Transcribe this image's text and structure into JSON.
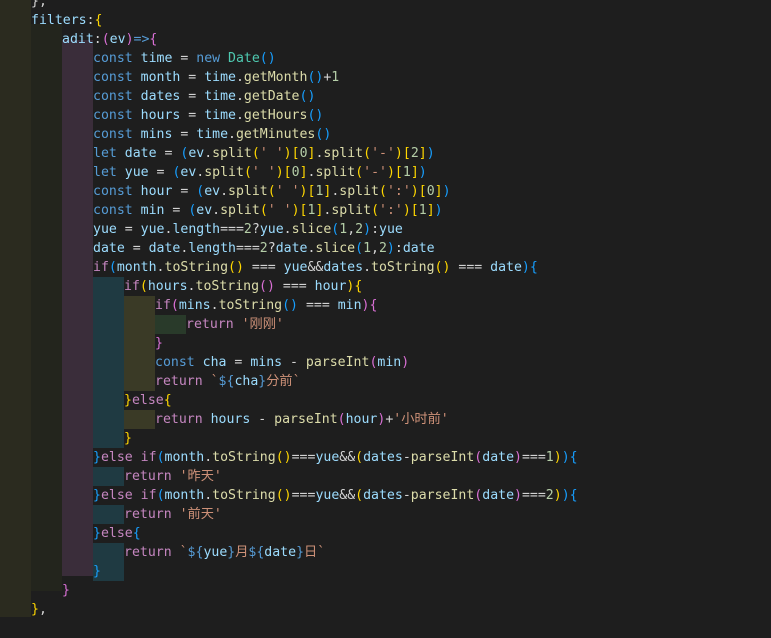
{
  "editor": {
    "background": "#1e1e1e",
    "theme_colors": {
      "keyword": "#569cd6",
      "control": "#c586c0",
      "function": "#dcdcaa",
      "number": "#b5cea8",
      "string": "#ce9178",
      "variable": "#9cdcfe",
      "bracket_level1": "#ffd700",
      "bracket_level2": "#da70d6",
      "bracket_level3": "#179fff"
    },
    "lines": [
      [
        [
          "plain",
          "},"
        ]
      ],
      [
        [
          "var",
          "filters"
        ],
        [
          "plain",
          ":"
        ],
        [
          "b1",
          "{"
        ]
      ],
      [
        [
          "var",
          "adit"
        ],
        [
          "plain",
          ":"
        ],
        [
          "b2",
          "("
        ],
        [
          "var",
          "ev"
        ],
        [
          "b2",
          ")"
        ],
        [
          "kw",
          "=>"
        ],
        [
          "b2",
          "{"
        ]
      ],
      [
        [
          "kw",
          "const"
        ],
        [
          "plain",
          " "
        ],
        [
          "var",
          "time"
        ],
        [
          "plain",
          " = "
        ],
        [
          "kw",
          "new"
        ],
        [
          "plain",
          " "
        ],
        [
          "cls",
          "Date"
        ],
        [
          "b3",
          "("
        ],
        [
          "b3",
          ")"
        ]
      ],
      [
        [
          "kw",
          "const"
        ],
        [
          "plain",
          " "
        ],
        [
          "var",
          "month"
        ],
        [
          "plain",
          " = "
        ],
        [
          "var",
          "time"
        ],
        [
          "plain",
          "."
        ],
        [
          "fn",
          "getMonth"
        ],
        [
          "b3",
          "("
        ],
        [
          "b3",
          ")"
        ],
        [
          "plain",
          "+"
        ],
        [
          "num",
          "1"
        ]
      ],
      [
        [
          "kw",
          "const"
        ],
        [
          "plain",
          " "
        ],
        [
          "var",
          "dates"
        ],
        [
          "plain",
          " = "
        ],
        [
          "var",
          "time"
        ],
        [
          "plain",
          "."
        ],
        [
          "fn",
          "getDate"
        ],
        [
          "b3",
          "("
        ],
        [
          "b3",
          ")"
        ]
      ],
      [
        [
          "kw",
          "const"
        ],
        [
          "plain",
          " "
        ],
        [
          "var",
          "hours"
        ],
        [
          "plain",
          " = "
        ],
        [
          "var",
          "time"
        ],
        [
          "plain",
          "."
        ],
        [
          "fn",
          "getHours"
        ],
        [
          "b3",
          "("
        ],
        [
          "b3",
          ")"
        ]
      ],
      [
        [
          "kw",
          "const"
        ],
        [
          "plain",
          " "
        ],
        [
          "var",
          "mins"
        ],
        [
          "plain",
          " = "
        ],
        [
          "var",
          "time"
        ],
        [
          "plain",
          "."
        ],
        [
          "fn",
          "getMinutes"
        ],
        [
          "b3",
          "("
        ],
        [
          "b3",
          ")"
        ]
      ],
      [
        [
          "kw",
          "let"
        ],
        [
          "plain",
          " "
        ],
        [
          "var",
          "date"
        ],
        [
          "plain",
          " = "
        ],
        [
          "b3",
          "("
        ],
        [
          "var",
          "ev"
        ],
        [
          "plain",
          "."
        ],
        [
          "fn",
          "split"
        ],
        [
          "b1",
          "("
        ],
        [
          "str",
          "' '"
        ],
        [
          "b1",
          ")"
        ],
        [
          "b1",
          "["
        ],
        [
          "num",
          "0"
        ],
        [
          "b1",
          "]"
        ],
        [
          "plain",
          "."
        ],
        [
          "fn",
          "split"
        ],
        [
          "b1",
          "("
        ],
        [
          "str",
          "'-'"
        ],
        [
          "b1",
          ")"
        ],
        [
          "b1",
          "["
        ],
        [
          "num",
          "2"
        ],
        [
          "b1",
          "]"
        ],
        [
          "b3",
          ")"
        ]
      ],
      [
        [
          "kw",
          "let"
        ],
        [
          "plain",
          " "
        ],
        [
          "var",
          "yue"
        ],
        [
          "plain",
          " = "
        ],
        [
          "b3",
          "("
        ],
        [
          "var",
          "ev"
        ],
        [
          "plain",
          "."
        ],
        [
          "fn",
          "split"
        ],
        [
          "b1",
          "("
        ],
        [
          "str",
          "' '"
        ],
        [
          "b1",
          ")"
        ],
        [
          "b1",
          "["
        ],
        [
          "num",
          "0"
        ],
        [
          "b1",
          "]"
        ],
        [
          "plain",
          "."
        ],
        [
          "fn",
          "split"
        ],
        [
          "b1",
          "("
        ],
        [
          "str",
          "'-'"
        ],
        [
          "b1",
          ")"
        ],
        [
          "b1",
          "["
        ],
        [
          "num",
          "1"
        ],
        [
          "b1",
          "]"
        ],
        [
          "b3",
          ")"
        ]
      ],
      [
        [
          "kw",
          "const"
        ],
        [
          "plain",
          " "
        ],
        [
          "var",
          "hour"
        ],
        [
          "plain",
          " = "
        ],
        [
          "b3",
          "("
        ],
        [
          "var",
          "ev"
        ],
        [
          "plain",
          "."
        ],
        [
          "fn",
          "split"
        ],
        [
          "b1",
          "("
        ],
        [
          "str",
          "' '"
        ],
        [
          "b1",
          ")"
        ],
        [
          "b1",
          "["
        ],
        [
          "num",
          "1"
        ],
        [
          "b1",
          "]"
        ],
        [
          "plain",
          "."
        ],
        [
          "fn",
          "split"
        ],
        [
          "b1",
          "("
        ],
        [
          "str",
          "':'"
        ],
        [
          "b1",
          ")"
        ],
        [
          "b1",
          "["
        ],
        [
          "num",
          "0"
        ],
        [
          "b1",
          "]"
        ],
        [
          "b3",
          ")"
        ]
      ],
      [
        [
          "kw",
          "const"
        ],
        [
          "plain",
          " "
        ],
        [
          "var",
          "min"
        ],
        [
          "plain",
          " = "
        ],
        [
          "b3",
          "("
        ],
        [
          "var",
          "ev"
        ],
        [
          "plain",
          "."
        ],
        [
          "fn",
          "split"
        ],
        [
          "b1",
          "("
        ],
        [
          "str",
          "' '"
        ],
        [
          "b1",
          ")"
        ],
        [
          "b1",
          "["
        ],
        [
          "num",
          "1"
        ],
        [
          "b1",
          "]"
        ],
        [
          "plain",
          "."
        ],
        [
          "fn",
          "split"
        ],
        [
          "b1",
          "("
        ],
        [
          "str",
          "':'"
        ],
        [
          "b1",
          ")"
        ],
        [
          "b1",
          "["
        ],
        [
          "num",
          "1"
        ],
        [
          "b1",
          "]"
        ],
        [
          "b3",
          ")"
        ]
      ],
      [
        [
          "var",
          "yue"
        ],
        [
          "plain",
          " = "
        ],
        [
          "var",
          "yue"
        ],
        [
          "plain",
          "."
        ],
        [
          "var",
          "length"
        ],
        [
          "plain",
          "==="
        ],
        [
          "num",
          "2"
        ],
        [
          "plain",
          "?"
        ],
        [
          "var",
          "yue"
        ],
        [
          "plain",
          "."
        ],
        [
          "fn",
          "slice"
        ],
        [
          "b3",
          "("
        ],
        [
          "num",
          "1"
        ],
        [
          "plain",
          ","
        ],
        [
          "num",
          "2"
        ],
        [
          "b3",
          ")"
        ],
        [
          "plain",
          ":"
        ],
        [
          "var",
          "yue"
        ]
      ],
      [
        [
          "var",
          "date"
        ],
        [
          "plain",
          " = "
        ],
        [
          "var",
          "date"
        ],
        [
          "plain",
          "."
        ],
        [
          "var",
          "length"
        ],
        [
          "plain",
          "==="
        ],
        [
          "num",
          "2"
        ],
        [
          "plain",
          "?"
        ],
        [
          "var",
          "date"
        ],
        [
          "plain",
          "."
        ],
        [
          "fn",
          "slice"
        ],
        [
          "b3",
          "("
        ],
        [
          "num",
          "1"
        ],
        [
          "plain",
          ","
        ],
        [
          "num",
          "2"
        ],
        [
          "b3",
          ")"
        ],
        [
          "plain",
          ":"
        ],
        [
          "var",
          "date"
        ]
      ],
      [
        [
          "ctl",
          "if"
        ],
        [
          "b3",
          "("
        ],
        [
          "var",
          "month"
        ],
        [
          "plain",
          "."
        ],
        [
          "fn",
          "toString"
        ],
        [
          "b1",
          "("
        ],
        [
          "b1",
          ")"
        ],
        [
          "plain",
          " === "
        ],
        [
          "var",
          "yue"
        ],
        [
          "plain",
          "&&"
        ],
        [
          "var",
          "dates"
        ],
        [
          "plain",
          "."
        ],
        [
          "fn",
          "toString"
        ],
        [
          "b1",
          "("
        ],
        [
          "b1",
          ")"
        ],
        [
          "plain",
          " === "
        ],
        [
          "var",
          "date"
        ],
        [
          "b3",
          ")"
        ],
        [
          "b3",
          "{"
        ]
      ],
      [
        [
          "ctl",
          "if"
        ],
        [
          "b1",
          "("
        ],
        [
          "var",
          "hours"
        ],
        [
          "plain",
          "."
        ],
        [
          "fn",
          "toString"
        ],
        [
          "b2",
          "("
        ],
        [
          "b2",
          ")"
        ],
        [
          "plain",
          " === "
        ],
        [
          "var",
          "hour"
        ],
        [
          "b1",
          ")"
        ],
        [
          "b1",
          "{"
        ]
      ],
      [
        [
          "ctl",
          "if"
        ],
        [
          "b2",
          "("
        ],
        [
          "var",
          "mins"
        ],
        [
          "plain",
          "."
        ],
        [
          "fn",
          "toString"
        ],
        [
          "b3",
          "("
        ],
        [
          "b3",
          ")"
        ],
        [
          "plain",
          " === "
        ],
        [
          "var",
          "min"
        ],
        [
          "b2",
          ")"
        ],
        [
          "b2",
          "{"
        ]
      ],
      [
        [
          "ctl",
          "return"
        ],
        [
          "plain",
          " "
        ],
        [
          "str",
          "'刚刚'"
        ]
      ],
      [
        [
          "b2",
          "}"
        ]
      ],
      [
        [
          "kw",
          "const"
        ],
        [
          "plain",
          " "
        ],
        [
          "var",
          "cha"
        ],
        [
          "plain",
          " = "
        ],
        [
          "var",
          "mins"
        ],
        [
          "plain",
          " - "
        ],
        [
          "fn",
          "parseInt"
        ],
        [
          "b2",
          "("
        ],
        [
          "var",
          "min"
        ],
        [
          "b2",
          ")"
        ]
      ],
      [
        [
          "ctl",
          "return"
        ],
        [
          "plain",
          " "
        ],
        [
          "str",
          "`"
        ],
        [
          "kw",
          "${"
        ],
        [
          "var",
          "cha"
        ],
        [
          "kw",
          "}"
        ],
        [
          "str",
          "分前`"
        ]
      ],
      [
        [
          "b1",
          "}"
        ],
        [
          "ctl",
          "else"
        ],
        [
          "b1",
          "{"
        ]
      ],
      [
        [
          "ctl",
          "return"
        ],
        [
          "plain",
          " "
        ],
        [
          "var",
          "hours"
        ],
        [
          "plain",
          " - "
        ],
        [
          "fn",
          "parseInt"
        ],
        [
          "b2",
          "("
        ],
        [
          "var",
          "hour"
        ],
        [
          "b2",
          ")"
        ],
        [
          "plain",
          "+"
        ],
        [
          "str",
          "'小时前'"
        ]
      ],
      [
        [
          "b1",
          "}"
        ]
      ],
      [
        [
          "b3",
          "}"
        ],
        [
          "ctl",
          "else"
        ],
        [
          "plain",
          " "
        ],
        [
          "ctl",
          "if"
        ],
        [
          "b3",
          "("
        ],
        [
          "var",
          "month"
        ],
        [
          "plain",
          "."
        ],
        [
          "fn",
          "toString"
        ],
        [
          "b1",
          "("
        ],
        [
          "b1",
          ")"
        ],
        [
          "plain",
          "==="
        ],
        [
          "var",
          "yue"
        ],
        [
          "plain",
          "&&"
        ],
        [
          "b1",
          "("
        ],
        [
          "var",
          "dates"
        ],
        [
          "plain",
          "-"
        ],
        [
          "fn",
          "parseInt"
        ],
        [
          "b2",
          "("
        ],
        [
          "var",
          "date"
        ],
        [
          "b2",
          ")"
        ],
        [
          "plain",
          "==="
        ],
        [
          "num",
          "1"
        ],
        [
          "b1",
          ")"
        ],
        [
          "b3",
          ")"
        ],
        [
          "b3",
          "{"
        ]
      ],
      [
        [
          "ctl",
          "return"
        ],
        [
          "plain",
          " "
        ],
        [
          "str",
          "'昨天'"
        ]
      ],
      [
        [
          "b3",
          "}"
        ],
        [
          "ctl",
          "else"
        ],
        [
          "plain",
          " "
        ],
        [
          "ctl",
          "if"
        ],
        [
          "b3",
          "("
        ],
        [
          "var",
          "month"
        ],
        [
          "plain",
          "."
        ],
        [
          "fn",
          "toString"
        ],
        [
          "b1",
          "("
        ],
        [
          "b1",
          ")"
        ],
        [
          "plain",
          "==="
        ],
        [
          "var",
          "yue"
        ],
        [
          "plain",
          "&&"
        ],
        [
          "b1",
          "("
        ],
        [
          "var",
          "dates"
        ],
        [
          "plain",
          "-"
        ],
        [
          "fn",
          "parseInt"
        ],
        [
          "b2",
          "("
        ],
        [
          "var",
          "date"
        ],
        [
          "b2",
          ")"
        ],
        [
          "plain",
          "==="
        ],
        [
          "num",
          "2"
        ],
        [
          "b1",
          ")"
        ],
        [
          "b3",
          ")"
        ],
        [
          "b3",
          "{"
        ]
      ],
      [
        [
          "ctl",
          "return"
        ],
        [
          "plain",
          " "
        ],
        [
          "str",
          "'前天'"
        ]
      ],
      [
        [
          "b3",
          "}"
        ],
        [
          "ctl",
          "else"
        ],
        [
          "b3",
          "{"
        ]
      ],
      [
        [
          "ctl",
          "return"
        ],
        [
          "plain",
          " "
        ],
        [
          "str",
          "`"
        ],
        [
          "kw",
          "${"
        ],
        [
          "var",
          "yue"
        ],
        [
          "kw",
          "}"
        ],
        [
          "str",
          "月"
        ],
        [
          "kw",
          "${"
        ],
        [
          "var",
          "date"
        ],
        [
          "kw",
          "}"
        ],
        [
          "str",
          "日`"
        ]
      ],
      [
        [
          "b3",
          "}"
        ]
      ],
      [
        [
          "b2",
          "}"
        ]
      ],
      [
        [
          "b1",
          "}"
        ],
        [
          "plain",
          ","
        ]
      ],
      [
        [
          "plain",
          "  "
        ]
      ]
    ]
  }
}
